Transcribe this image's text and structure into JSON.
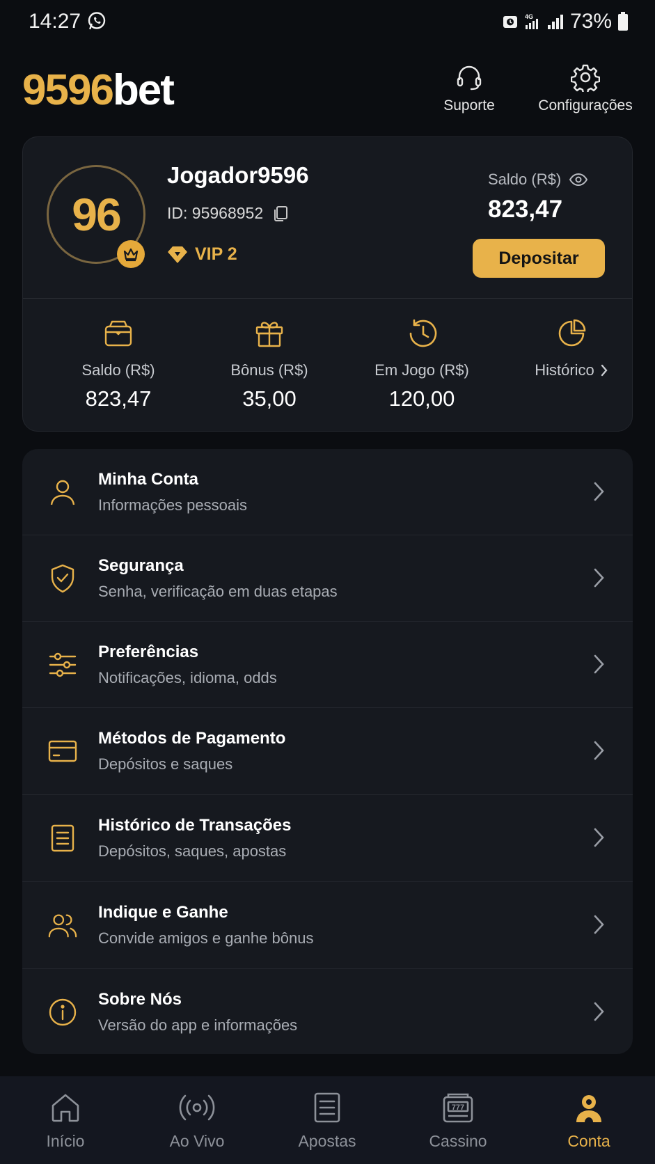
{
  "status_bar": {
    "time": "14:27",
    "network": "4G",
    "battery": "73%"
  },
  "header": {
    "logo_number": "9596",
    "logo_text": "bet",
    "support_label": "Suporte",
    "settings_label": "Configurações"
  },
  "profile": {
    "avatar_text": "96",
    "username": "Jogador9596",
    "id_text": "ID: 95968952",
    "vip_label": "VIP 2",
    "balance_label": "Saldo (R$)",
    "balance_value": "823,47",
    "deposit_label": "Depositar"
  },
  "stats": [
    {
      "icon": "wallet-icon",
      "label": "Saldo (R$)",
      "value": "823,47"
    },
    {
      "icon": "gift-icon",
      "label": "Bônus (R$)",
      "value": "35,00"
    },
    {
      "icon": "history-clock-icon",
      "label": "Em Jogo (R$)",
      "value": "120,00"
    },
    {
      "icon": "pie-chart-icon",
      "label": "Histórico",
      "value": ""
    }
  ],
  "menu": [
    {
      "icon": "user-icon",
      "title": "Minha Conta",
      "subtitle": "Informações pessoais"
    },
    {
      "icon": "shield-check-icon",
      "title": "Segurança",
      "subtitle": "Senha, verificação em duas etapas"
    },
    {
      "icon": "sliders-icon",
      "title": "Preferências",
      "subtitle": "Notificações, idioma, odds"
    },
    {
      "icon": "credit-card-icon",
      "title": "Métodos de Pagamento",
      "subtitle": "Depósitos e saques"
    },
    {
      "icon": "document-icon",
      "title": "Histórico de Transações",
      "subtitle": "Depósitos, saques, apostas"
    },
    {
      "icon": "users-icon",
      "title": "Indique e Ganhe",
      "subtitle": "Convide amigos e ganhe bônus"
    },
    {
      "icon": "info-icon",
      "title": "Sobre Nós",
      "subtitle": "Versão do app e informações"
    }
  ],
  "bottom_nav": [
    {
      "icon": "home-icon",
      "label": "Início",
      "active": false
    },
    {
      "icon": "live-icon",
      "label": "Ao Vivo",
      "active": false
    },
    {
      "icon": "bets-icon",
      "label": "Apostas",
      "active": false
    },
    {
      "icon": "slot-machine-icon",
      "label": "Cassino",
      "active": false
    },
    {
      "icon": "account-icon",
      "label": "Conta",
      "active": true
    }
  ],
  "colors": {
    "accent": "#e8b24a",
    "background": "#0b0d11",
    "card": "#16191f",
    "muted_text": "#a9adb4"
  }
}
